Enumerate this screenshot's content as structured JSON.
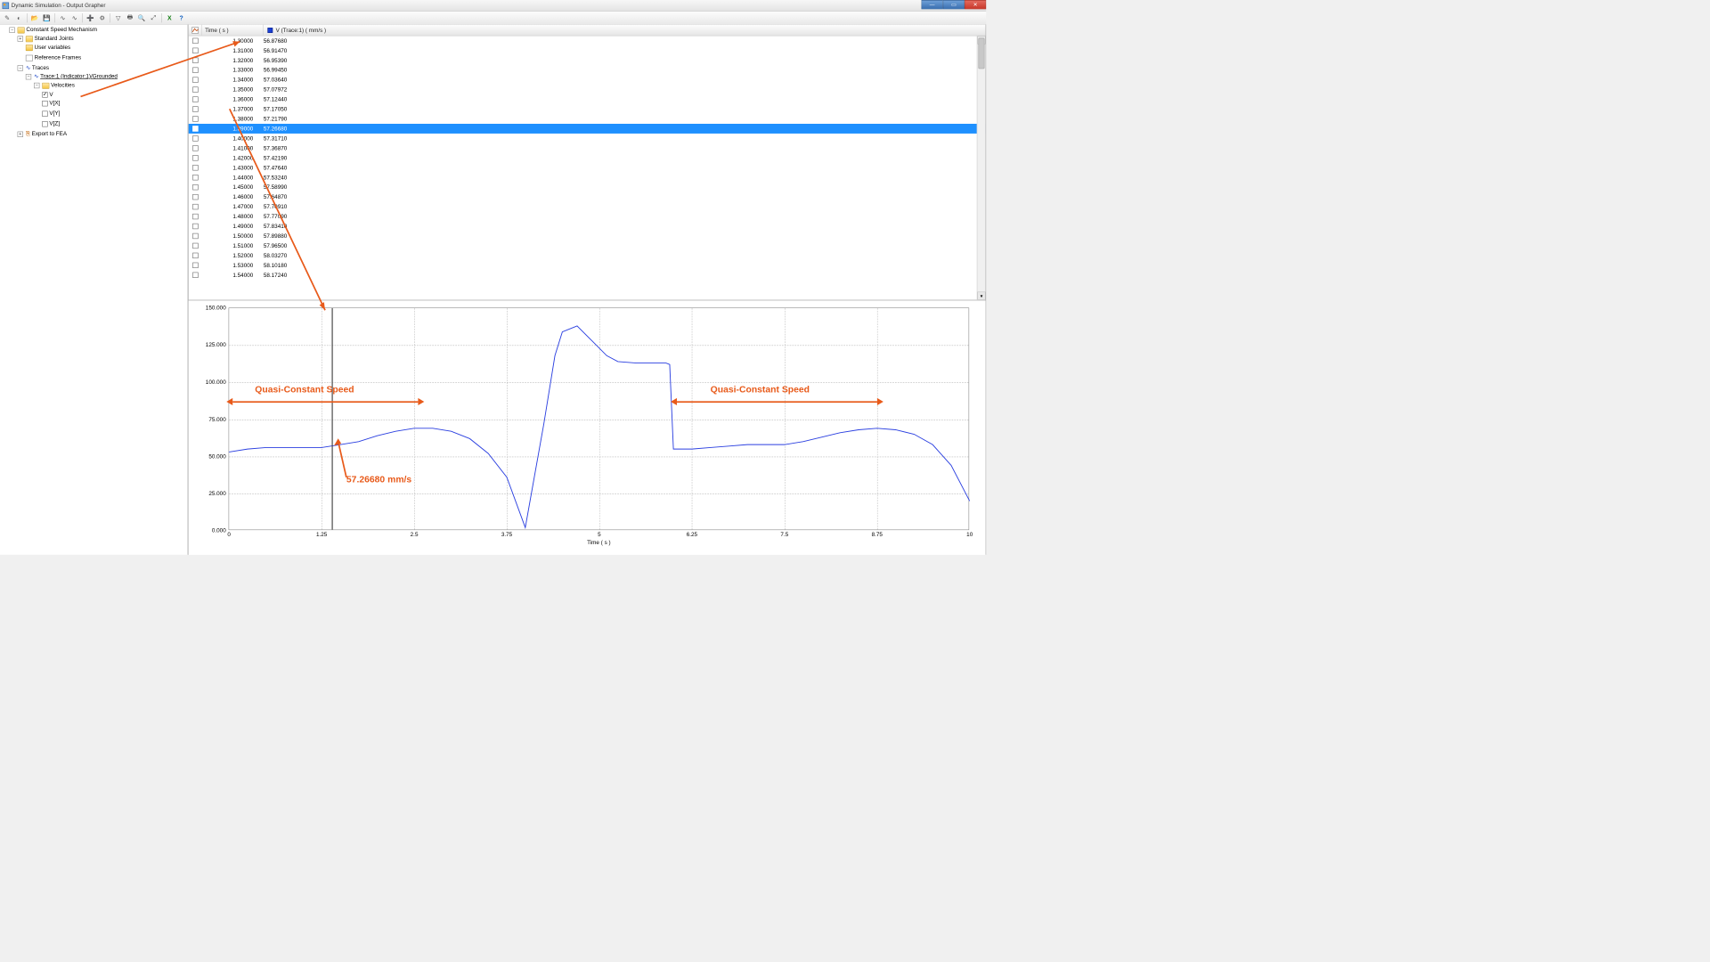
{
  "window": {
    "title": "Dynamic Simulation - Output Grapher"
  },
  "tree": {
    "root": "Constant Speed Mechanism",
    "standard_joints": "Standard Joints",
    "user_variables": "User variables",
    "reference_frames": "Reference Frames",
    "traces": "Traces",
    "trace1": "Trace:1 (Indicator:1)/Grounded",
    "velocities": "Velocities",
    "v": "V",
    "vx": "V[X]",
    "vy": "V[Y]",
    "vz": "V[Z]",
    "export_fea": "Export to FEA"
  },
  "table": {
    "col_time": "Time ( s )",
    "col_v": "V (Trace:1) ( mm/s )",
    "selected_index": 9,
    "rows": [
      {
        "t": "1.30000",
        "v": "56.87680"
      },
      {
        "t": "1.31000",
        "v": "56.91470"
      },
      {
        "t": "1.32000",
        "v": "56.95390"
      },
      {
        "t": "1.33000",
        "v": "56.99450"
      },
      {
        "t": "1.34000",
        "v": "57.03640"
      },
      {
        "t": "1.35000",
        "v": "57.07972"
      },
      {
        "t": "1.36000",
        "v": "57.12440"
      },
      {
        "t": "1.37000",
        "v": "57.17050"
      },
      {
        "t": "1.38000",
        "v": "57.21790"
      },
      {
        "t": "1.39000",
        "v": "57.26680"
      },
      {
        "t": "1.40000",
        "v": "57.31710"
      },
      {
        "t": "1.41000",
        "v": "57.36870"
      },
      {
        "t": "1.42000",
        "v": "57.42190"
      },
      {
        "t": "1.43000",
        "v": "57.47640"
      },
      {
        "t": "1.44000",
        "v": "57.53240"
      },
      {
        "t": "1.45000",
        "v": "57.58990"
      },
      {
        "t": "1.46000",
        "v": "57.64870"
      },
      {
        "t": "1.47000",
        "v": "57.70910"
      },
      {
        "t": "1.48000",
        "v": "57.77090"
      },
      {
        "t": "1.49000",
        "v": "57.83410"
      },
      {
        "t": "1.50000",
        "v": "57.89880"
      },
      {
        "t": "1.51000",
        "v": "57.96500"
      },
      {
        "t": "1.52000",
        "v": "58.03270"
      },
      {
        "t": "1.53000",
        "v": "58.10180"
      },
      {
        "t": "1.54000",
        "v": "58.17240"
      }
    ]
  },
  "chart_data": {
    "type": "line",
    "title": "",
    "xlabel": "Time ( s )",
    "ylabel": "",
    "xlim": [
      0,
      10
    ],
    "ylim": [
      0,
      150
    ],
    "xticks": [
      0,
      1.25,
      2.5,
      3.75,
      5,
      6.25,
      7.5,
      8.75,
      10
    ],
    "yticks": [
      0,
      25,
      50,
      75,
      100,
      125,
      150
    ],
    "xtick_labels": [
      "0",
      "1.25",
      "2.5",
      "3.75",
      "5",
      "6.25",
      "7.5",
      "8.75",
      "10"
    ],
    "ytick_labels": [
      "0.000",
      "25.000",
      "50.000",
      "75.000",
      "100.000",
      "125.000",
      "150.000"
    ],
    "cursor_x": 1.39,
    "series": [
      {
        "name": "V (Trace:1)",
        "color": "#2a3fe0",
        "x": [
          0,
          0.25,
          0.5,
          0.75,
          1.0,
          1.25,
          1.5,
          1.75,
          2.0,
          2.25,
          2.5,
          2.75,
          3.0,
          3.25,
          3.5,
          3.75,
          4.0,
          4.1,
          4.25,
          4.4,
          4.5,
          4.7,
          4.9,
          5.1,
          5.25,
          5.5,
          5.75,
          5.9,
          5.95,
          6.0,
          6.25,
          6.5,
          6.75,
          7.0,
          7.25,
          7.5,
          7.75,
          8.0,
          8.25,
          8.5,
          8.75,
          9.0,
          9.25,
          9.5,
          9.75,
          10.0
        ],
        "y": [
          53,
          55,
          56,
          56,
          56,
          56,
          58,
          60,
          64,
          67,
          69,
          69,
          67,
          62,
          52,
          36,
          2,
          30,
          72,
          118,
          134,
          138,
          128,
          118,
          114,
          113,
          113,
          113,
          112,
          55,
          55,
          56,
          57,
          58,
          58,
          58,
          60,
          63,
          66,
          68,
          69,
          68,
          65,
          58,
          44,
          20
        ]
      }
    ]
  },
  "annotations": {
    "qcs1": "Quasi-Constant Speed",
    "qcs2": "Quasi-Constant Speed",
    "cursor_value": "57.26680 mm/s"
  }
}
